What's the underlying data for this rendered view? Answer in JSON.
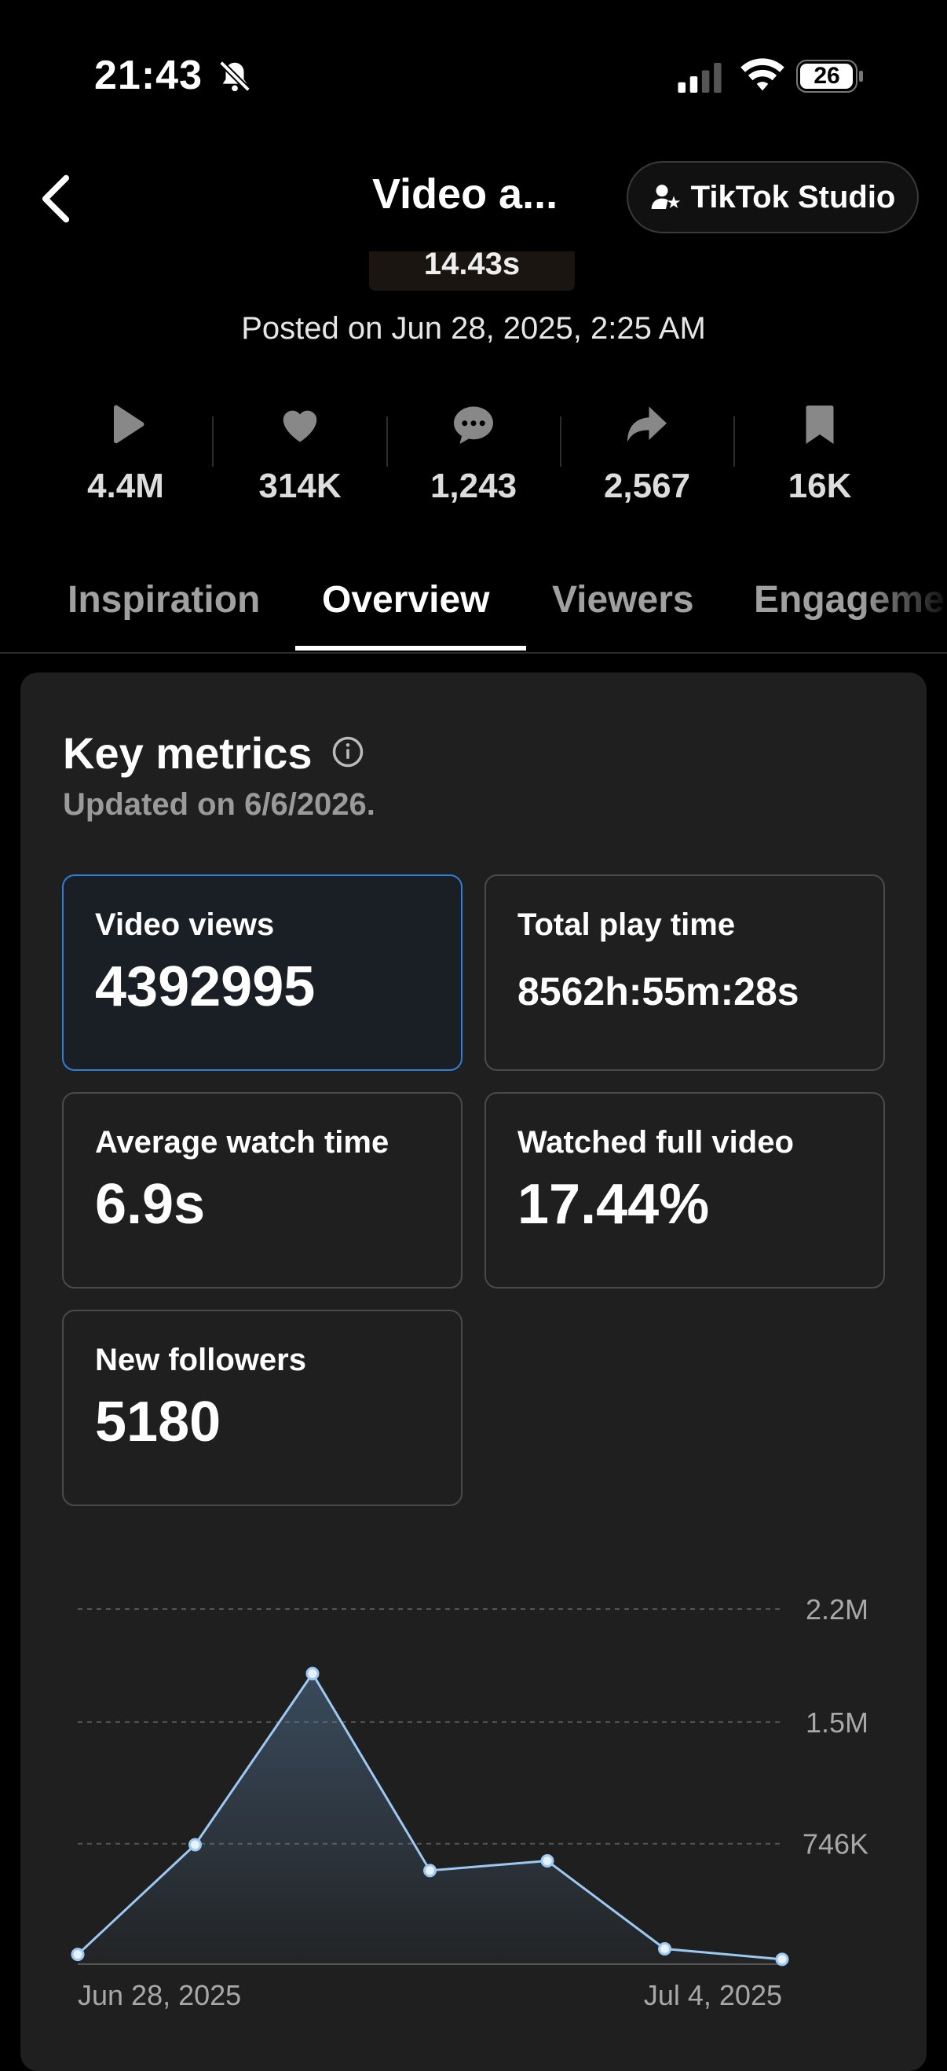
{
  "status_bar": {
    "time": "21:43",
    "battery": "26"
  },
  "nav": {
    "title": "Video a...",
    "studio_label": "TikTok Studio"
  },
  "video": {
    "duration": "14.43s",
    "posted": "Posted on Jun 28, 2025, 2:25 AM"
  },
  "stats": [
    {
      "icon": "play-icon",
      "value": "4.4M"
    },
    {
      "icon": "heart-icon",
      "value": "314K"
    },
    {
      "icon": "comment-icon",
      "value": "1,243"
    },
    {
      "icon": "share-icon",
      "value": "2,567"
    },
    {
      "icon": "bookmark-icon",
      "value": "16K"
    }
  ],
  "tabs": [
    {
      "label": "Inspiration",
      "active": false
    },
    {
      "label": "Overview",
      "active": true
    },
    {
      "label": "Viewers",
      "active": false
    },
    {
      "label": "Engagement",
      "active": false
    }
  ],
  "key_metrics": {
    "title": "Key metrics",
    "updated": "Updated on 6/6/2026.",
    "tiles": [
      {
        "label": "Video views",
        "value": "4392995",
        "selected": true
      },
      {
        "label": "Total play time",
        "value": "8562h:55m:28s",
        "selected": false
      },
      {
        "label": "Average watch time",
        "value": "6.9s",
        "selected": false
      },
      {
        "label": "Watched full video",
        "value": "17.44%",
        "selected": false
      },
      {
        "label": "New followers",
        "value": "5180",
        "selected": false
      }
    ]
  },
  "colors": {
    "accent": "#2e7fd8",
    "line": "#9cc8f2",
    "card_bg": "#1f1f1f"
  },
  "chart_data": {
    "type": "area",
    "x": [
      "Jun 28, 2025",
      "Jun 29, 2025",
      "Jun 30, 2025",
      "Jul 1, 2025",
      "Jul 2, 2025",
      "Jul 3, 2025",
      "Jul 4, 2025"
    ],
    "values": [
      60000,
      740000,
      1800000,
      580000,
      640000,
      95000,
      30000
    ],
    "y_ticks": [
      746000,
      1500000,
      2200000
    ],
    "y_tick_labels": [
      "746K",
      "1.5M",
      "2.2M"
    ],
    "x_tick_labels": [
      "Jun 28, 2025",
      "Jul 4, 2025"
    ],
    "ylim": [
      0,
      2200000
    ],
    "grid": true
  }
}
